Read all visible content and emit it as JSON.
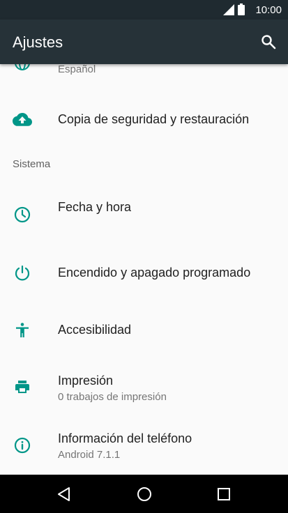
{
  "status_bar": {
    "time": "10:00",
    "icons": [
      "signal-icon",
      "battery-icon"
    ]
  },
  "app_bar": {
    "title": "Ajustes",
    "search_icon": "search-icon"
  },
  "colors": {
    "app_bar": "#263238",
    "status_bar": "#1f2a30",
    "accent": "#009688",
    "background": "#fafafa",
    "nav_bar": "#000000"
  },
  "list": {
    "language_item": {
      "subtitle": "Español",
      "icon": "globe-icon"
    },
    "backup_item": {
      "title": "Copia de seguridad y restauración",
      "icon": "cloud-upload-icon"
    },
    "system_header": "Sistema",
    "date_time_item": {
      "title": "Fecha y hora",
      "icon": "clock-icon"
    },
    "power_item": {
      "title": "Encendido y apagado programado",
      "icon": "power-icon"
    },
    "accessibility_item": {
      "title": "Accesibilidad",
      "icon": "accessibility-icon"
    },
    "printing_item": {
      "title": "Impresión",
      "subtitle": "0 trabajos de impresión",
      "icon": "printer-icon"
    },
    "about_item": {
      "title": "Información del teléfono",
      "subtitle": "Android 7.1.1",
      "icon": "info-icon"
    }
  },
  "nav_bar": {
    "buttons": [
      "back-icon",
      "home-icon",
      "recents-icon"
    ]
  }
}
